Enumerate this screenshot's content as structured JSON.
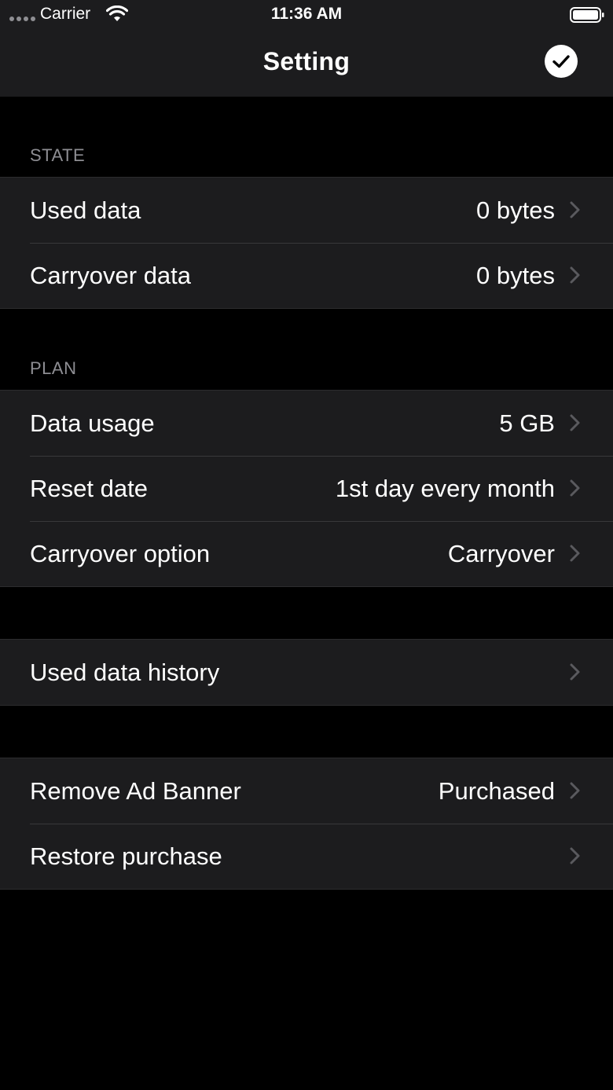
{
  "status_bar": {
    "carrier": "Carrier",
    "time": "11:36 AM"
  },
  "nav": {
    "title": "Setting",
    "done_icon": "checkmark-circle-icon"
  },
  "sections": {
    "state": {
      "header": "STATE",
      "rows": [
        {
          "label": "Used data",
          "value": "0 bytes"
        },
        {
          "label": "Carryover data",
          "value": "0 bytes"
        }
      ]
    },
    "plan": {
      "header": "PLAN",
      "rows": [
        {
          "label": "Data usage",
          "value": "5 GB"
        },
        {
          "label": "Reset date",
          "value": "1st day every month"
        },
        {
          "label": "Carryover option",
          "value": "Carryover"
        }
      ]
    },
    "history": {
      "rows": [
        {
          "label": "Used data history",
          "value": ""
        }
      ]
    },
    "purchase": {
      "rows": [
        {
          "label": "Remove Ad Banner",
          "value": "Purchased"
        },
        {
          "label": "Restore purchase",
          "value": ""
        }
      ]
    }
  },
  "colors": {
    "background": "#000000",
    "cell_background": "#1c1c1e",
    "header_text": "#8e8e93",
    "chevron": "#5a5a5e"
  }
}
